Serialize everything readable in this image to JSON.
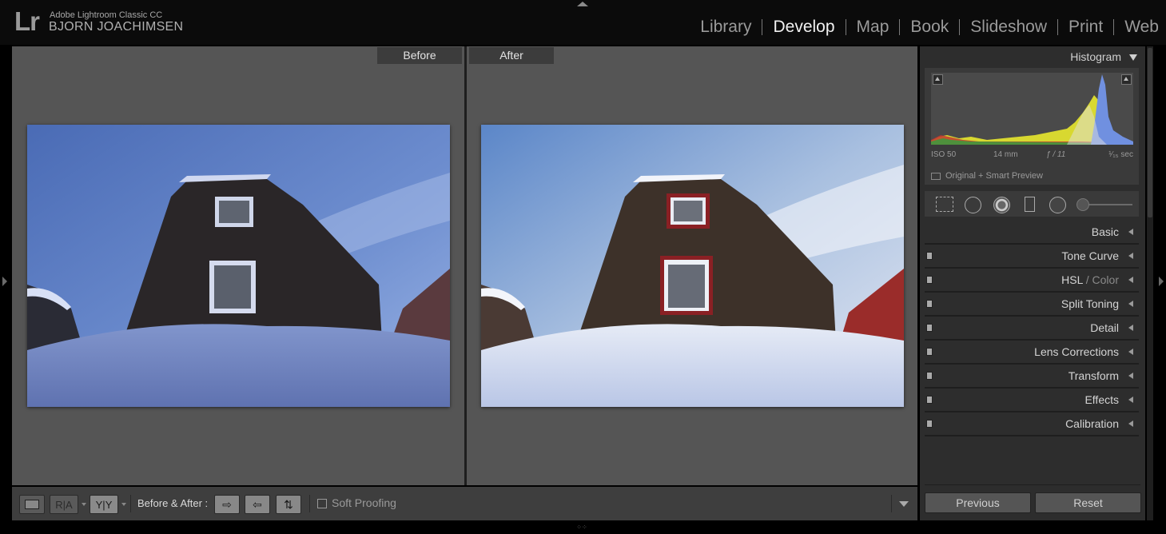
{
  "top_bar": {
    "logo": "Lr",
    "app_name": "Adobe Lightroom Classic CC",
    "user_name": "BJORN JOACHIMSEN",
    "modules": [
      {
        "label": "Library",
        "active": false
      },
      {
        "label": "Develop",
        "active": true
      },
      {
        "label": "Map",
        "active": false
      },
      {
        "label": "Book",
        "active": false
      },
      {
        "label": "Slideshow",
        "active": false
      },
      {
        "label": "Print",
        "active": false
      },
      {
        "label": "Web",
        "active": false
      }
    ]
  },
  "view": {
    "before_label": "Before",
    "after_label": "After"
  },
  "toolbar": {
    "ra_label": "R|A",
    "yy_label": "Y|Y",
    "before_after_label": "Before & After :",
    "soft_proofing_label": "Soft Proofing",
    "soft_proofing_checked": false
  },
  "histogram": {
    "title": "Histogram",
    "iso": "ISO 50",
    "focal_length": "14 mm",
    "aperture": "ƒ / 11",
    "shutter": "¹⁄₁₅ sec",
    "preview_status": "Original + Smart Preview"
  },
  "tools": [
    "crop-tool",
    "spot-removal",
    "red-eye",
    "graduated-filter",
    "radial-filter",
    "adjustment-brush"
  ],
  "panels": [
    {
      "label": "Basic",
      "has_switch": false
    },
    {
      "label": "Tone Curve",
      "has_switch": true
    },
    {
      "label_main": "HSL",
      "label_sep": " / ",
      "label_gray": "Color",
      "has_switch": true
    },
    {
      "label": "Split Toning",
      "has_switch": true
    },
    {
      "label": "Detail",
      "has_switch": true
    },
    {
      "label": "Lens Corrections",
      "has_switch": true
    },
    {
      "label": "Transform",
      "has_switch": true
    },
    {
      "label": "Effects",
      "has_switch": true
    },
    {
      "label": "Calibration",
      "has_switch": true
    }
  ],
  "buttons": {
    "previous": "Previous",
    "reset": "Reset"
  },
  "colors": {
    "background": "#000000",
    "panel": "#2d2d2d",
    "view": "#555555",
    "active_module": "#f0f0f0"
  }
}
